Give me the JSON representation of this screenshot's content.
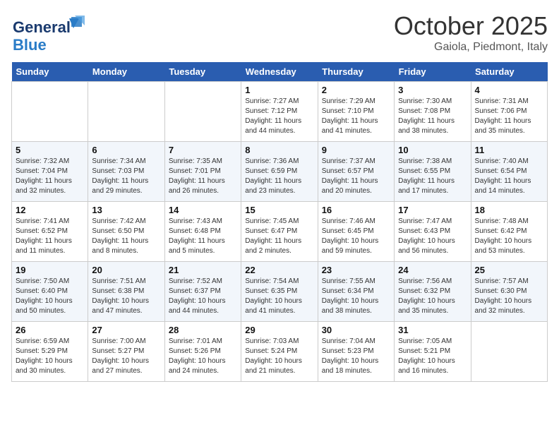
{
  "header": {
    "logo_general": "General",
    "logo_blue": "Blue",
    "month": "October 2025",
    "location": "Gaiola, Piedmont, Italy"
  },
  "days_of_week": [
    "Sunday",
    "Monday",
    "Tuesday",
    "Wednesday",
    "Thursday",
    "Friday",
    "Saturday"
  ],
  "weeks": [
    [
      {
        "day": "",
        "info": ""
      },
      {
        "day": "",
        "info": ""
      },
      {
        "day": "",
        "info": ""
      },
      {
        "day": "1",
        "info": "Sunrise: 7:27 AM\nSunset: 7:12 PM\nDaylight: 11 hours\nand 44 minutes."
      },
      {
        "day": "2",
        "info": "Sunrise: 7:29 AM\nSunset: 7:10 PM\nDaylight: 11 hours\nand 41 minutes."
      },
      {
        "day": "3",
        "info": "Sunrise: 7:30 AM\nSunset: 7:08 PM\nDaylight: 11 hours\nand 38 minutes."
      },
      {
        "day": "4",
        "info": "Sunrise: 7:31 AM\nSunset: 7:06 PM\nDaylight: 11 hours\nand 35 minutes."
      }
    ],
    [
      {
        "day": "5",
        "info": "Sunrise: 7:32 AM\nSunset: 7:04 PM\nDaylight: 11 hours\nand 32 minutes."
      },
      {
        "day": "6",
        "info": "Sunrise: 7:34 AM\nSunset: 7:03 PM\nDaylight: 11 hours\nand 29 minutes."
      },
      {
        "day": "7",
        "info": "Sunrise: 7:35 AM\nSunset: 7:01 PM\nDaylight: 11 hours\nand 26 minutes."
      },
      {
        "day": "8",
        "info": "Sunrise: 7:36 AM\nSunset: 6:59 PM\nDaylight: 11 hours\nand 23 minutes."
      },
      {
        "day": "9",
        "info": "Sunrise: 7:37 AM\nSunset: 6:57 PM\nDaylight: 11 hours\nand 20 minutes."
      },
      {
        "day": "10",
        "info": "Sunrise: 7:38 AM\nSunset: 6:55 PM\nDaylight: 11 hours\nand 17 minutes."
      },
      {
        "day": "11",
        "info": "Sunrise: 7:40 AM\nSunset: 6:54 PM\nDaylight: 11 hours\nand 14 minutes."
      }
    ],
    [
      {
        "day": "12",
        "info": "Sunrise: 7:41 AM\nSunset: 6:52 PM\nDaylight: 11 hours\nand 11 minutes."
      },
      {
        "day": "13",
        "info": "Sunrise: 7:42 AM\nSunset: 6:50 PM\nDaylight: 11 hours\nand 8 minutes."
      },
      {
        "day": "14",
        "info": "Sunrise: 7:43 AM\nSunset: 6:48 PM\nDaylight: 11 hours\nand 5 minutes."
      },
      {
        "day": "15",
        "info": "Sunrise: 7:45 AM\nSunset: 6:47 PM\nDaylight: 11 hours\nand 2 minutes."
      },
      {
        "day": "16",
        "info": "Sunrise: 7:46 AM\nSunset: 6:45 PM\nDaylight: 10 hours\nand 59 minutes."
      },
      {
        "day": "17",
        "info": "Sunrise: 7:47 AM\nSunset: 6:43 PM\nDaylight: 10 hours\nand 56 minutes."
      },
      {
        "day": "18",
        "info": "Sunrise: 7:48 AM\nSunset: 6:42 PM\nDaylight: 10 hours\nand 53 minutes."
      }
    ],
    [
      {
        "day": "19",
        "info": "Sunrise: 7:50 AM\nSunset: 6:40 PM\nDaylight: 10 hours\nand 50 minutes."
      },
      {
        "day": "20",
        "info": "Sunrise: 7:51 AM\nSunset: 6:38 PM\nDaylight: 10 hours\nand 47 minutes."
      },
      {
        "day": "21",
        "info": "Sunrise: 7:52 AM\nSunset: 6:37 PM\nDaylight: 10 hours\nand 44 minutes."
      },
      {
        "day": "22",
        "info": "Sunrise: 7:54 AM\nSunset: 6:35 PM\nDaylight: 10 hours\nand 41 minutes."
      },
      {
        "day": "23",
        "info": "Sunrise: 7:55 AM\nSunset: 6:34 PM\nDaylight: 10 hours\nand 38 minutes."
      },
      {
        "day": "24",
        "info": "Sunrise: 7:56 AM\nSunset: 6:32 PM\nDaylight: 10 hours\nand 35 minutes."
      },
      {
        "day": "25",
        "info": "Sunrise: 7:57 AM\nSunset: 6:30 PM\nDaylight: 10 hours\nand 32 minutes."
      }
    ],
    [
      {
        "day": "26",
        "info": "Sunrise: 6:59 AM\nSunset: 5:29 PM\nDaylight: 10 hours\nand 30 minutes."
      },
      {
        "day": "27",
        "info": "Sunrise: 7:00 AM\nSunset: 5:27 PM\nDaylight: 10 hours\nand 27 minutes."
      },
      {
        "day": "28",
        "info": "Sunrise: 7:01 AM\nSunset: 5:26 PM\nDaylight: 10 hours\nand 24 minutes."
      },
      {
        "day": "29",
        "info": "Sunrise: 7:03 AM\nSunset: 5:24 PM\nDaylight: 10 hours\nand 21 minutes."
      },
      {
        "day": "30",
        "info": "Sunrise: 7:04 AM\nSunset: 5:23 PM\nDaylight: 10 hours\nand 18 minutes."
      },
      {
        "day": "31",
        "info": "Sunrise: 7:05 AM\nSunset: 5:21 PM\nDaylight: 10 hours\nand 16 minutes."
      },
      {
        "day": "",
        "info": ""
      }
    ]
  ]
}
